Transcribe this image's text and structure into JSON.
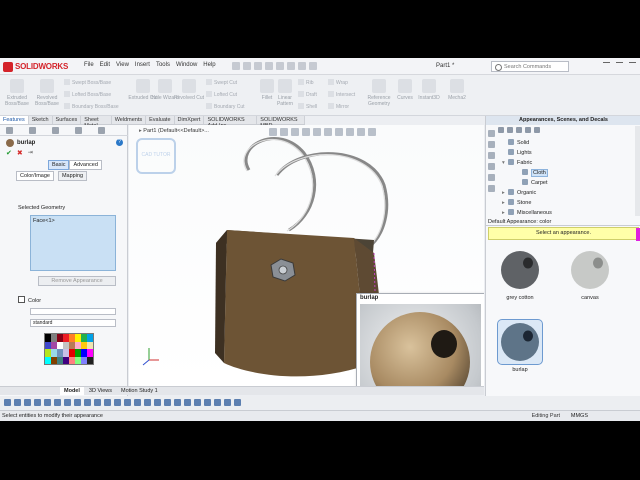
{
  "app": {
    "brand": "SOLIDWORKS",
    "doc_title": "Part1 *"
  },
  "menu": [
    "File",
    "Edit",
    "View",
    "Insert",
    "Tools",
    "Window",
    "Help"
  ],
  "search": {
    "placeholder": "Search Commands"
  },
  "ribbon": {
    "large": [
      "Extruded Boss/Base",
      "Revolved Boss/Base",
      "Extruded Cut",
      "Hole Wizard",
      "Revolved Cut",
      "Fillet",
      "Linear Pattern",
      "Reference Geometry",
      "Curves",
      "Instant3D",
      "Mecha2"
    ],
    "small": [
      "Swept Boss/Base",
      "Lofted Boss/Base",
      "Boundary Boss/Base",
      "Swept Cut",
      "Lofted Cut",
      "Boundary Cut",
      "Rib",
      "Draft",
      "Shell",
      "Wrap",
      "Intersect",
      "Mirror"
    ]
  },
  "tabs": [
    "Features",
    "Sketch",
    "Surfaces",
    "Sheet Metal",
    "Weldments",
    "Evaluate",
    "DimXpert",
    "SOLIDWORKS Add-Ins",
    "SOLIDWORKS MBD"
  ],
  "active_tab": "Features",
  "property": {
    "title": "burlap",
    "modes": [
      "Basic",
      "Advanced"
    ],
    "subtabs": [
      "Color/Image",
      "Mapping"
    ],
    "selected_geometry_label": "Selected Geometry",
    "face": "Face<1>",
    "remove_label": "Remove Appearance",
    "color_label": "Color",
    "standard_label": "standard",
    "palette": [
      "#000000",
      "#7f7f7f",
      "#880015",
      "#ed1c24",
      "#ff7f27",
      "#fff200",
      "#22b14c",
      "#00a2e8",
      "#3f48cc",
      "#a349a4",
      "#ffffff",
      "#c3c3c3",
      "#b97a57",
      "#ffaec9",
      "#ffc90e",
      "#efe4b0",
      "#b5e61d",
      "#99d9ea",
      "#7092be",
      "#c8bfe7",
      "#e10000",
      "#00a000",
      "#0000ff",
      "#ff00ff",
      "#00ffff",
      "#804000",
      "#408080",
      "#400080",
      "#ff8080",
      "#80ff80",
      "#8080ff",
      "#202020"
    ]
  },
  "viewport": {
    "tree_label": "Part1 (Default<<Default>...",
    "watermark": "CAD TUTOR",
    "popup_title": "burlap"
  },
  "taskpane": {
    "title": "Appearances, Scenes, and Decals",
    "tree": [
      {
        "label": "Solid",
        "indent": 1,
        "exp": ""
      },
      {
        "label": "Lights",
        "indent": 1,
        "exp": ""
      },
      {
        "label": "Fabric",
        "indent": 1,
        "exp": "▾"
      },
      {
        "label": "Cloth",
        "indent": 2,
        "exp": "",
        "selected": true
      },
      {
        "label": "Carpet",
        "indent": 2,
        "exp": ""
      },
      {
        "label": "Organic",
        "indent": 1,
        "exp": "▸"
      },
      {
        "label": "Stone",
        "indent": 1,
        "exp": "▸"
      },
      {
        "label": "Miscellaneous",
        "indent": 1,
        "exp": "▸"
      }
    ],
    "appearance_label": "Default Appearance: color",
    "tip": "Select an appearance.",
    "thumbs": [
      {
        "label": "grey cotton",
        "color": "#5f6266"
      },
      {
        "label": "canvas",
        "color": "#c7c9c7"
      },
      {
        "label": "burlap",
        "color": "#5e7488",
        "selected": true
      }
    ]
  },
  "bottom_tabs": [
    "Model",
    "3D Views",
    "Motion Study 1"
  ],
  "status": {
    "message": "Select entities to modify their appearance",
    "mode": "Editing Part",
    "units": "MMGS"
  }
}
